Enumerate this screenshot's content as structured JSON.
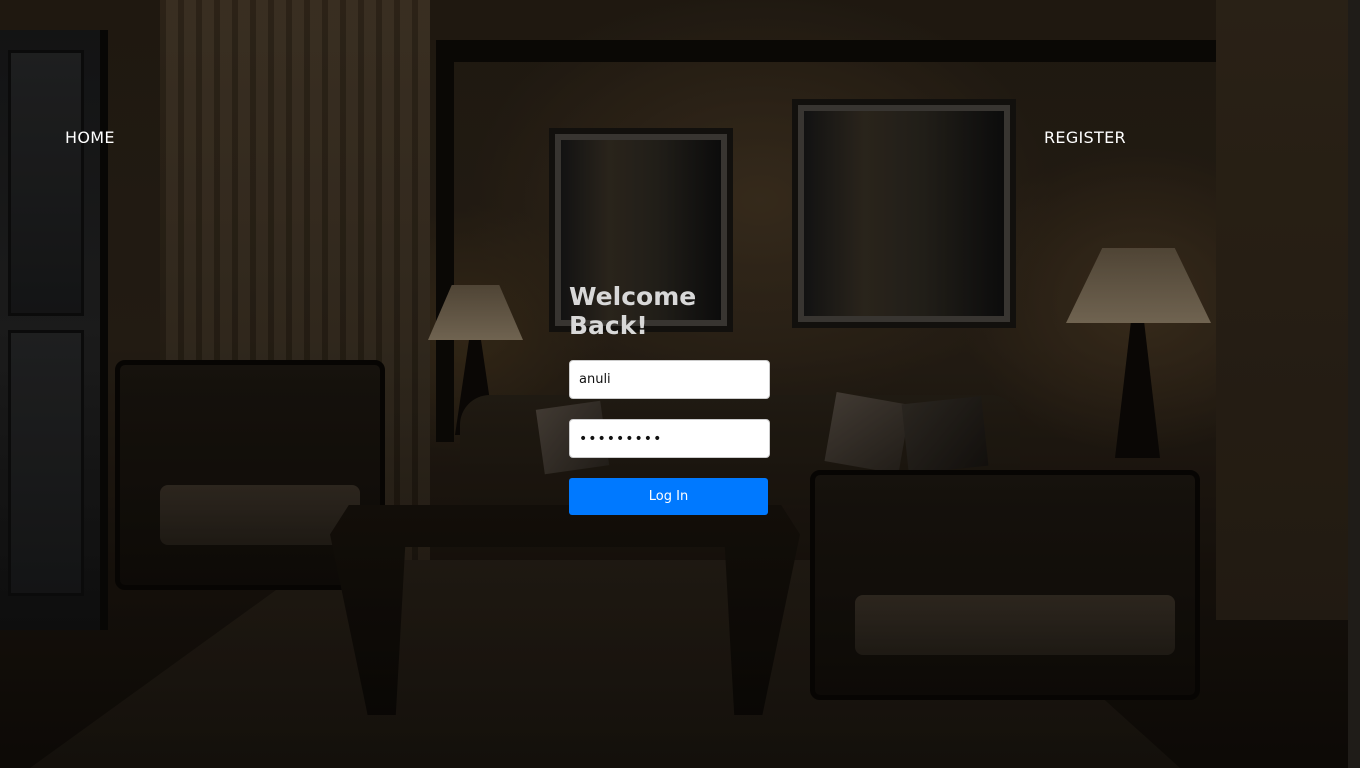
{
  "nav": {
    "home_label": "HOME",
    "register_label": "REGISTER"
  },
  "login": {
    "heading": "Welcome Back!",
    "username_value": "anuli",
    "password_value": "anuli1234",
    "submit_label": "Log In"
  },
  "colors": {
    "button_bg": "#0079ff",
    "heading_text": "#d8d8d8",
    "nav_text": "#ffffff"
  }
}
